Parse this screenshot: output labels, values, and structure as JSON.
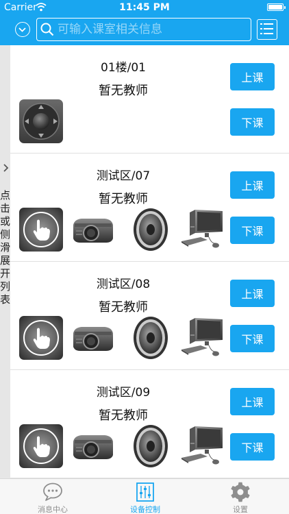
{
  "status_bar": {
    "carrier": "Carrier",
    "time": "11:45 PM"
  },
  "header": {
    "search_placeholder": "可输入课室相关信息"
  },
  "drawer": {
    "hint": "点击或侧滑展开列表"
  },
  "rooms": [
    {
      "name": "01楼/01",
      "teacher": "暂无教师",
      "start_label": "上课",
      "end_label": "下课",
      "devices": [
        "remote-control"
      ]
    },
    {
      "name": "测试区/07",
      "teacher": "暂无教师",
      "start_label": "上课",
      "end_label": "下课",
      "devices": [
        "touch",
        "projector",
        "speaker",
        "computer"
      ]
    },
    {
      "name": "测试区/08",
      "teacher": "暂无教师",
      "start_label": "上课",
      "end_label": "下课",
      "devices": [
        "touch",
        "projector",
        "speaker",
        "computer"
      ]
    },
    {
      "name": "测试区/09",
      "teacher": "暂无教师",
      "start_label": "上课",
      "end_label": "下课",
      "devices": [
        "touch",
        "projector",
        "speaker",
        "computer"
      ]
    }
  ],
  "tabbar": {
    "items": [
      {
        "label": "消息中心",
        "icon": "chat-bubble-icon",
        "active": false
      },
      {
        "label": "设备控制",
        "icon": "control-panel-icon",
        "active": true
      },
      {
        "label": "设置",
        "icon": "gear-icon",
        "active": false
      }
    ]
  },
  "colors": {
    "accent": "#19a6f0",
    "drawer_bg": "#e6e6e6",
    "tabbar_bg": "#f7f7f7"
  }
}
